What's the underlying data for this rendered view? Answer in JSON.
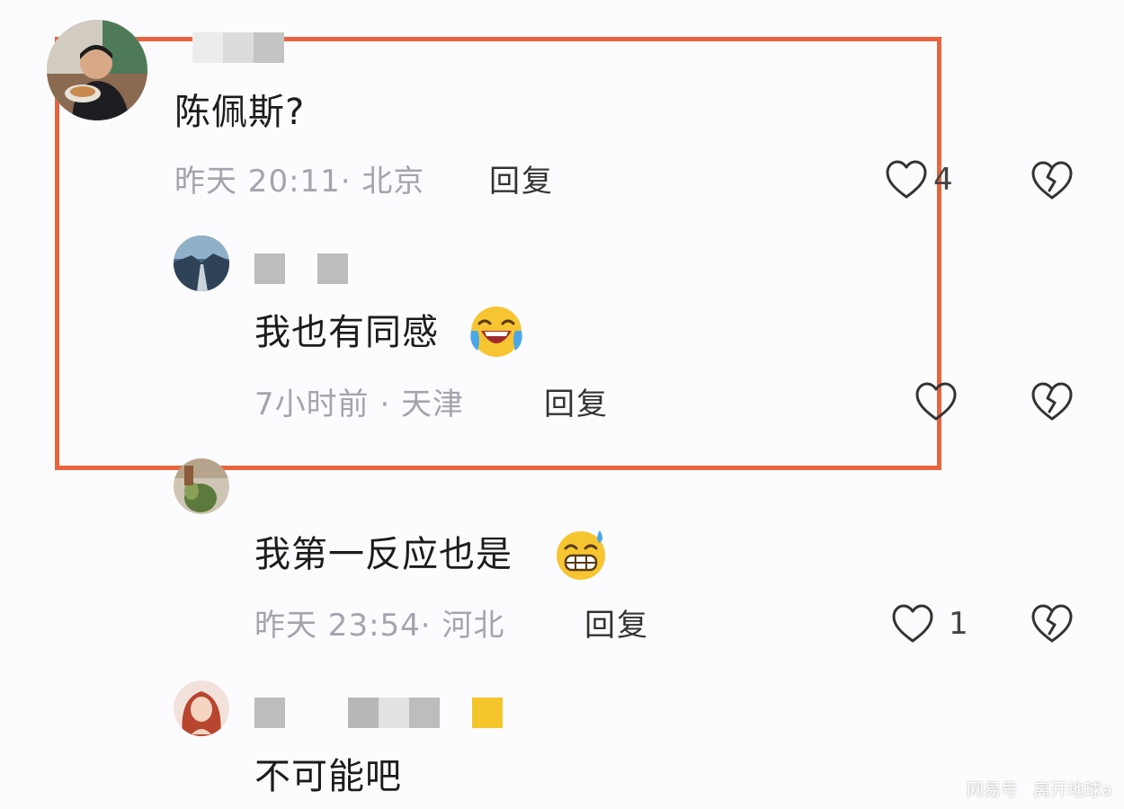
{
  "comments": [
    {
      "text": "陈佩斯?",
      "meta": "昨天 20:11· 北京",
      "reply_label": "回复",
      "like_count": "4"
    },
    {
      "text": "我也有同感",
      "meta": "7小时前 · 天津",
      "reply_label": "回复",
      "like_count": ""
    },
    {
      "text": "我第一反应也是",
      "meta": "昨天 23:54· 河北",
      "reply_label": "回复",
      "like_count": "1"
    },
    {
      "text": "不可能吧"
    }
  ],
  "watermark": {
    "brand": "网易号",
    "author": "离开地球a"
  },
  "colors": {
    "highlight_border": "#e8643e",
    "meta_text": "#a4a4ae",
    "icon_stroke": "#333333"
  },
  "icons": [
    "heart-outline-icon",
    "broken-heart-icon",
    "laughing-crying-emoji-icon",
    "grinning-sweat-emoji-icon"
  ]
}
